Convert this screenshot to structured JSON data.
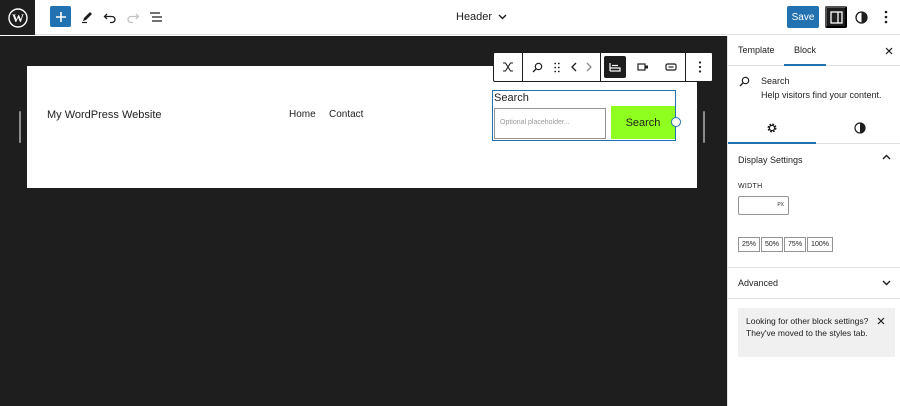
{
  "topbar": {
    "doc_title": "Header",
    "save_label": "Save",
    "icons": [
      "wordpress-logo",
      "plus-icon",
      "pencil-icon",
      "undo-icon",
      "redo-icon",
      "list-view-icon",
      "chevron-down-icon",
      "sidebar-icon",
      "contrast-icon",
      "kebab-menu-icon"
    ],
    "accent": "#2271b1"
  },
  "canvas": {
    "site_title": "My WordPress Website",
    "nav": [
      "Home",
      "Contact"
    ],
    "search": {
      "label": "Search",
      "placeholder": "Optional placeholder...",
      "button_label": "Search",
      "button_color": "#8fff1f"
    }
  },
  "sidebar": {
    "tabs": [
      "Template",
      "Block"
    ],
    "active_tab": "Block",
    "block": {
      "name": "Search",
      "description": "Help visitors find your content."
    },
    "display_settings": {
      "title": "Display Settings",
      "width_label": "WIDTH",
      "width_value": "",
      "width_unit": "PX",
      "percentages": [
        "25%",
        "50%",
        "75%",
        "100%"
      ]
    },
    "advanced_title": "Advanced",
    "notice": "Looking for other block settings? They've moved to the styles tab."
  }
}
